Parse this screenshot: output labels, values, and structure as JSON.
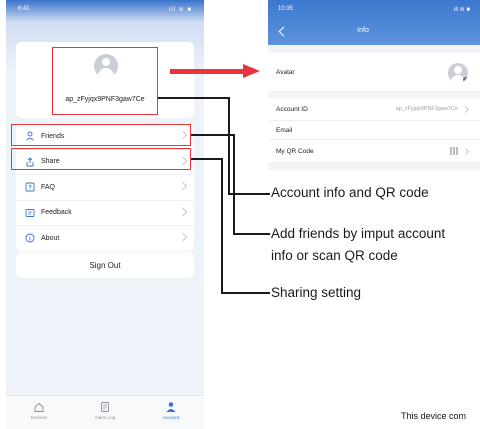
{
  "left_screen": {
    "status_bar": {
      "time": "6:41",
      "indicators": "ıll ≋ ■"
    },
    "profile": {
      "account_id": "ap_zFyjqx9PNF3gaw7Ce"
    },
    "menu": [
      {
        "label": "Friends",
        "icon": "person-icon"
      },
      {
        "label": "Share",
        "icon": "share-icon"
      },
      {
        "label": "FAQ",
        "icon": "faq-icon"
      },
      {
        "label": "Feedback",
        "icon": "feedback-icon"
      },
      {
        "label": "About",
        "icon": "info-icon"
      }
    ],
    "sign_out": "Sign Out",
    "tabs": [
      {
        "label": "Devices",
        "icon": "home-icon"
      },
      {
        "label": "Alarm Log",
        "icon": "log-icon"
      },
      {
        "label": "Account",
        "icon": "account-icon"
      }
    ]
  },
  "right_screen": {
    "status_bar": {
      "time": "10:35",
      "indicators": "ıll ≋ ■"
    },
    "title": "Info",
    "rows": {
      "avatar": "Avatar",
      "account_id_label": "Account ID",
      "account_id_value": "ap_zFyjqx9PNF3gaw7Ce",
      "email": "Email",
      "qr_code": "My QR Code"
    }
  },
  "annotations": {
    "account_info": "Account info and QR code",
    "add_friends_line1": "Add friends by imput account",
    "add_friends_line2": "info or scan QR code",
    "sharing": "Sharing setting",
    "footnote": "This device com"
  },
  "colors": {
    "highlight": "#e8343a",
    "accent": "#3a73cc"
  }
}
